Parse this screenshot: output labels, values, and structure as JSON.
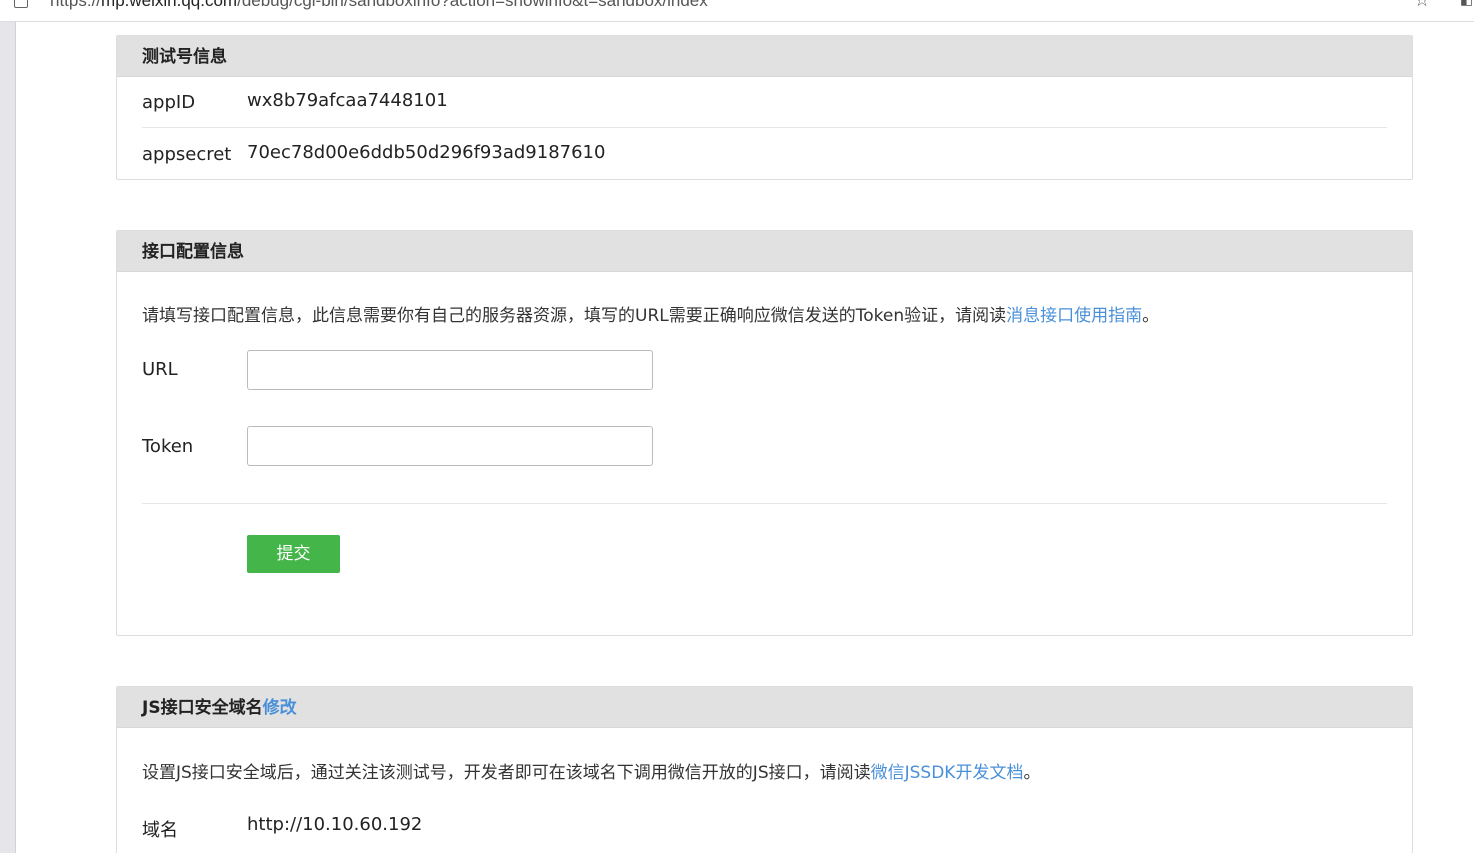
{
  "browser": {
    "url_prefix": "https://",
    "url_host": "mp.weixin.qq.com",
    "url_path": "/debug/cgi-bin/sandboxinfo?action=showinfo&t=sandbox/index"
  },
  "test_account": {
    "title": "测试号信息",
    "appid_label": "appID",
    "appid_value": "wx8b79afcaa7448101",
    "appsecret_label": "appsecret",
    "appsecret_value": "70ec78d00e6ddb50d296f93ad9187610"
  },
  "interface_config": {
    "title": "接口配置信息",
    "description": "请填写接口配置信息，此信息需要你有自己的服务器资源，填写的URL需要正确响应微信发送的Token验证，请阅读",
    "guide_link": "消息接口使用指南",
    "description_end": "。",
    "url_label": "URL",
    "url_value": "",
    "token_label": "Token",
    "token_value": "",
    "submit_label": "提交"
  },
  "js_domain": {
    "title": "JS接口安全域名",
    "modify_link": "修改",
    "description": "设置JS接口安全域后，通过关注该测试号，开发者即可在该域名下调用微信开放的JS接口，请阅读",
    "doc_link": "微信JSSDK开发文档",
    "description_end": "。",
    "domain_label": "域名",
    "domain_value": "http://10.10.60.192"
  },
  "colors": {
    "link": "#4a90d9",
    "submit_button": "#44b549",
    "panel_header": "#e1e1e1"
  }
}
